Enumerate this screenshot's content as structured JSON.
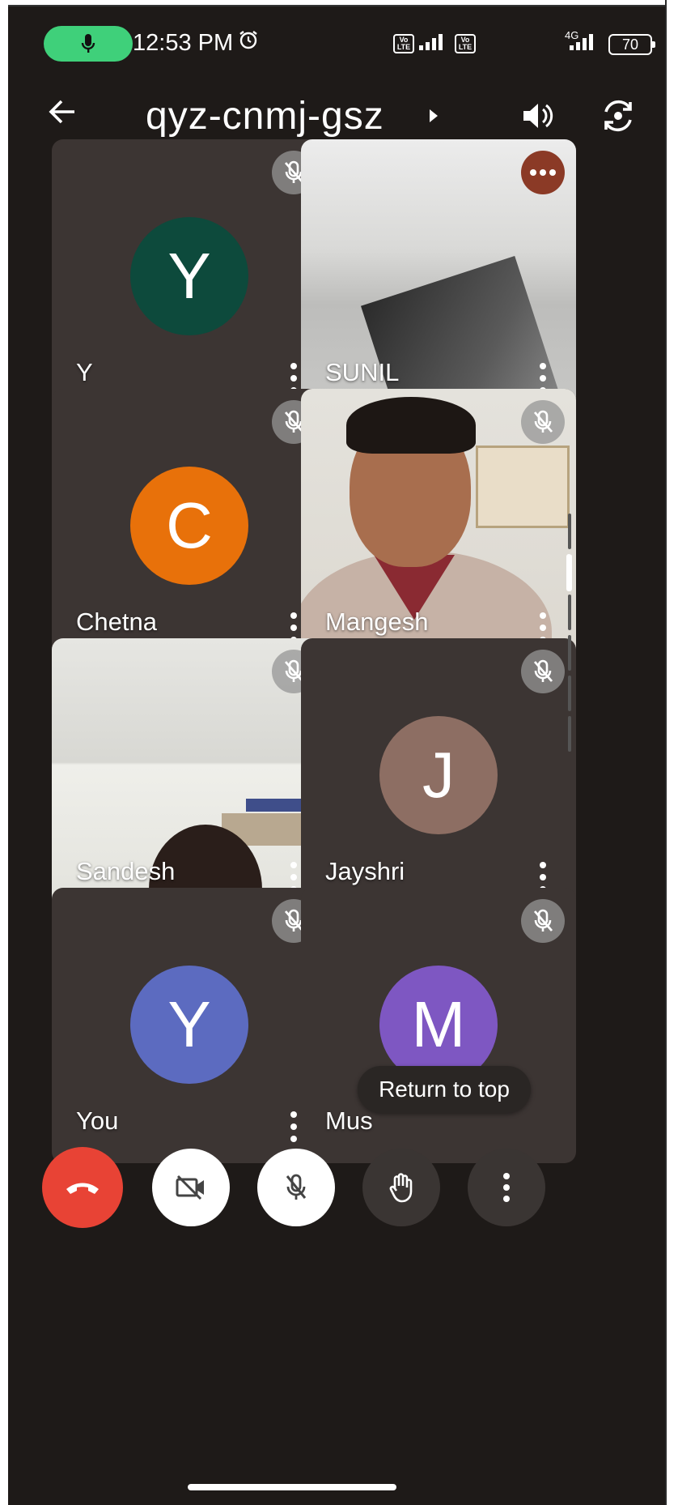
{
  "status_bar": {
    "time": "12:53 PM",
    "network_label": "4G",
    "battery": "70",
    "mic_active_color": "#3fd07a"
  },
  "header": {
    "meeting_code": "qyz-cnmj-gsz"
  },
  "participants": [
    {
      "name": "Y",
      "initial": "Y",
      "avatar_color": "#0d4a3c",
      "state": "muted"
    },
    {
      "name": "SUNIL",
      "initial": "",
      "avatar_color": "",
      "state": "speaking"
    },
    {
      "name": "Chetna",
      "initial": "C",
      "avatar_color": "#e8710a",
      "state": "muted"
    },
    {
      "name": "Mangesh",
      "initial": "",
      "avatar_color": "",
      "state": "muted"
    },
    {
      "name": "Sandesh",
      "initial": "",
      "avatar_color": "",
      "state": "muted"
    },
    {
      "name": "Jayshri",
      "initial": "J",
      "avatar_color": "#8d6e63",
      "state": "muted"
    },
    {
      "name": "You",
      "initial": "Y",
      "avatar_color": "#5c6bc0",
      "state": "muted"
    },
    {
      "name": "Mus",
      "initial": "M",
      "avatar_color": "#7e57c2",
      "state": "muted"
    }
  ],
  "return_to_top": "Return to top",
  "controls": {
    "end_call_color": "#e84335"
  }
}
